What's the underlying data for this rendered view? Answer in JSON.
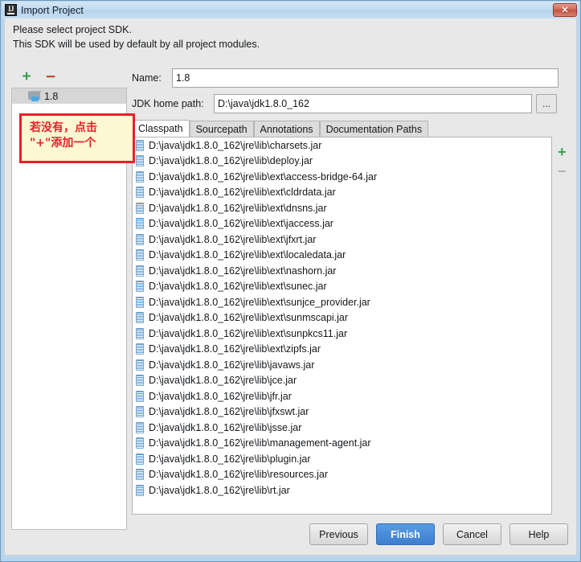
{
  "window": {
    "title": "Import Project",
    "app_icon": "intellij-idea-icon",
    "close_label": "✕",
    "frame_color": "#b9d6ef"
  },
  "header": {
    "line1": "Please select project SDK.",
    "line2": "This SDK will be used by default by all project modules."
  },
  "sdk_panel": {
    "add_label": "+",
    "remove_label": "−",
    "add_color": "#3c9e4f",
    "remove_color": "#b8503c",
    "items": [
      {
        "label": "1.8",
        "icon": "jdk-folder-icon",
        "selected": true
      }
    ]
  },
  "form": {
    "name_label": "Name:",
    "name_value": "1.8",
    "name_placeholder": "",
    "jdk_label": "JDK home path:",
    "jdk_value": "D:\\java\\jdk1.8.0_162",
    "jdk_placeholder": "",
    "browse_label": "..."
  },
  "tabs": [
    {
      "label": "Classpath",
      "active": true
    },
    {
      "label": "Sourcepath",
      "active": false
    },
    {
      "label": "Annotations",
      "active": false
    },
    {
      "label": "Documentation Paths",
      "active": false
    }
  ],
  "classpath": {
    "add_label": "+",
    "remove_label": "−",
    "add_color": "#3c9e4f",
    "remove_color": "#b0b0b0",
    "entries": [
      "D:\\java\\jdk1.8.0_162\\jre\\lib\\charsets.jar",
      "D:\\java\\jdk1.8.0_162\\jre\\lib\\deploy.jar",
      "D:\\java\\jdk1.8.0_162\\jre\\lib\\ext\\access-bridge-64.jar",
      "D:\\java\\jdk1.8.0_162\\jre\\lib\\ext\\cldrdata.jar",
      "D:\\java\\jdk1.8.0_162\\jre\\lib\\ext\\dnsns.jar",
      "D:\\java\\jdk1.8.0_162\\jre\\lib\\ext\\jaccess.jar",
      "D:\\java\\jdk1.8.0_162\\jre\\lib\\ext\\jfxrt.jar",
      "D:\\java\\jdk1.8.0_162\\jre\\lib\\ext\\localedata.jar",
      "D:\\java\\jdk1.8.0_162\\jre\\lib\\ext\\nashorn.jar",
      "D:\\java\\jdk1.8.0_162\\jre\\lib\\ext\\sunec.jar",
      "D:\\java\\jdk1.8.0_162\\jre\\lib\\ext\\sunjce_provider.jar",
      "D:\\java\\jdk1.8.0_162\\jre\\lib\\ext\\sunmscapi.jar",
      "D:\\java\\jdk1.8.0_162\\jre\\lib\\ext\\sunpkcs11.jar",
      "D:\\java\\jdk1.8.0_162\\jre\\lib\\ext\\zipfs.jar",
      "D:\\java\\jdk1.8.0_162\\jre\\lib\\javaws.jar",
      "D:\\java\\jdk1.8.0_162\\jre\\lib\\jce.jar",
      "D:\\java\\jdk1.8.0_162\\jre\\lib\\jfr.jar",
      "D:\\java\\jdk1.8.0_162\\jre\\lib\\jfxswt.jar",
      "D:\\java\\jdk1.8.0_162\\jre\\lib\\jsse.jar",
      "D:\\java\\jdk1.8.0_162\\jre\\lib\\management-agent.jar",
      "D:\\java\\jdk1.8.0_162\\jre\\lib\\plugin.jar",
      "D:\\java\\jdk1.8.0_162\\jre\\lib\\resources.jar",
      "D:\\java\\jdk1.8.0_162\\jre\\lib\\rt.jar"
    ]
  },
  "buttons": [
    {
      "label": "Previous",
      "default": false
    },
    {
      "label": "Finish",
      "default": true
    },
    {
      "label": "Cancel",
      "default": false
    },
    {
      "label": "Help",
      "default": false
    }
  ],
  "annotation": {
    "text": "若没有，点击\n\"+\"添加一个",
    "text_color": "#e8202a",
    "border_color": "#e8202a",
    "background_color": "#fbf8d2"
  }
}
